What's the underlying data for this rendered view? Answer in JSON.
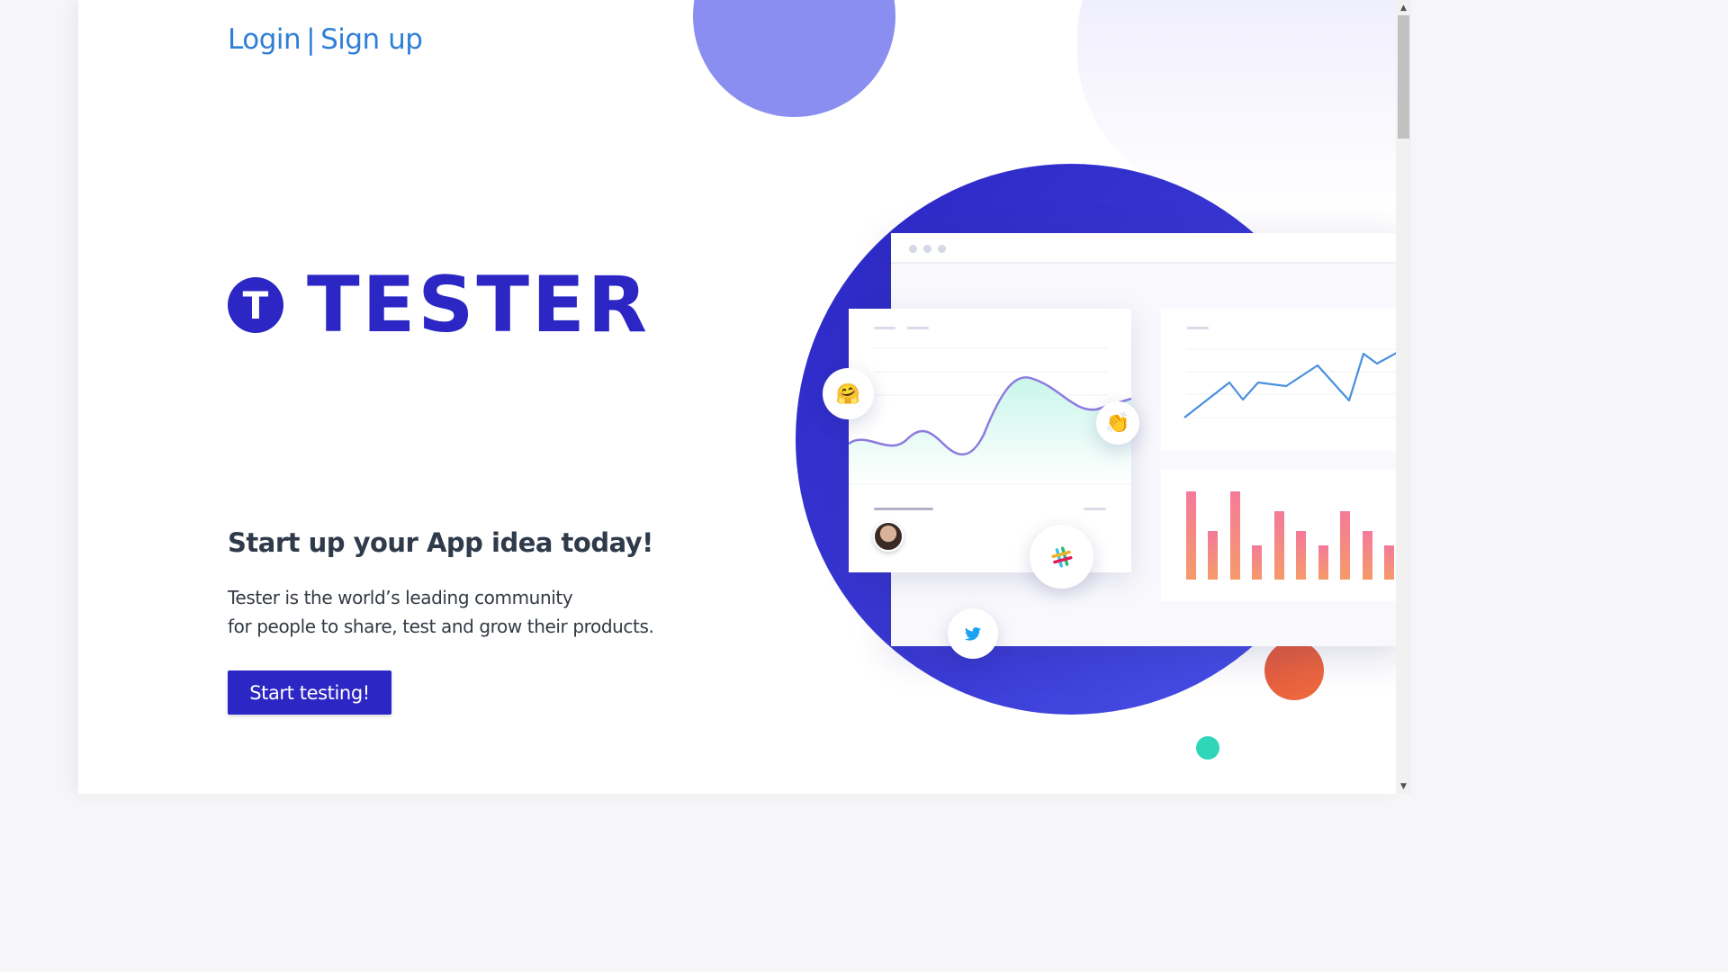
{
  "header": {
    "login_label": "Login",
    "separator": "|",
    "signup_label": "Sign up"
  },
  "logo": {
    "mark_letter": "T",
    "name": "TESTER"
  },
  "hero": {
    "headline": "Start up your App idea today!",
    "description_line1": "Tester is the world’s leading community",
    "description_line2": "for people to share, test and grow their products.",
    "cta_label": "Start testing!"
  },
  "illustration": {
    "emoji_hug": "🤗",
    "emoji_wave": "👏",
    "icons": [
      "twitter-icon",
      "slack-icon",
      "avatar"
    ]
  },
  "scrollbar": {
    "up_arrow": "▲",
    "down_arrow": "▼"
  },
  "colors": {
    "brand": "#2b26c4",
    "link": "#2f7fd6",
    "accent_orange": "#ec5f3f",
    "accent_teal": "#2fd6b7"
  }
}
